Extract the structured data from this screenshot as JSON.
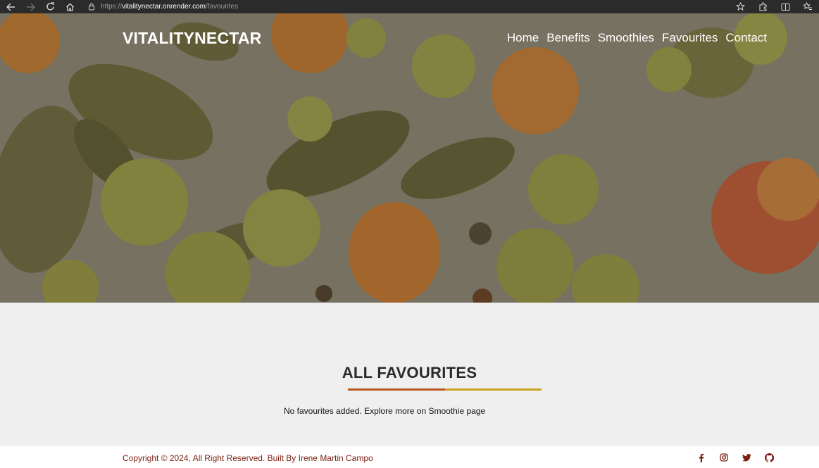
{
  "browser": {
    "url_prefix": "https://",
    "url_host": "vitalitynectar.onrender.com",
    "url_path": "/favourites"
  },
  "header": {
    "logo_part1": "VITALITY",
    "logo_part2": "NECTAR",
    "nav": [
      "Home",
      "Benefits",
      "Smoothies",
      "Favourites",
      "Contact"
    ]
  },
  "main": {
    "title": "ALL FAVOURITES",
    "empty_message": "No favourites added. Explore more on Smoothie page"
  },
  "footer": {
    "copyright": "Copyright © 2024, All Right Reserved. Built By Irene Martin Campo",
    "socials": [
      "facebook-icon",
      "instagram-icon",
      "twitter-icon",
      "github-icon"
    ]
  },
  "colors": {
    "underline_left": "#b9561d",
    "underline_right": "#c8a21e",
    "footer_text": "#7a1e10"
  }
}
